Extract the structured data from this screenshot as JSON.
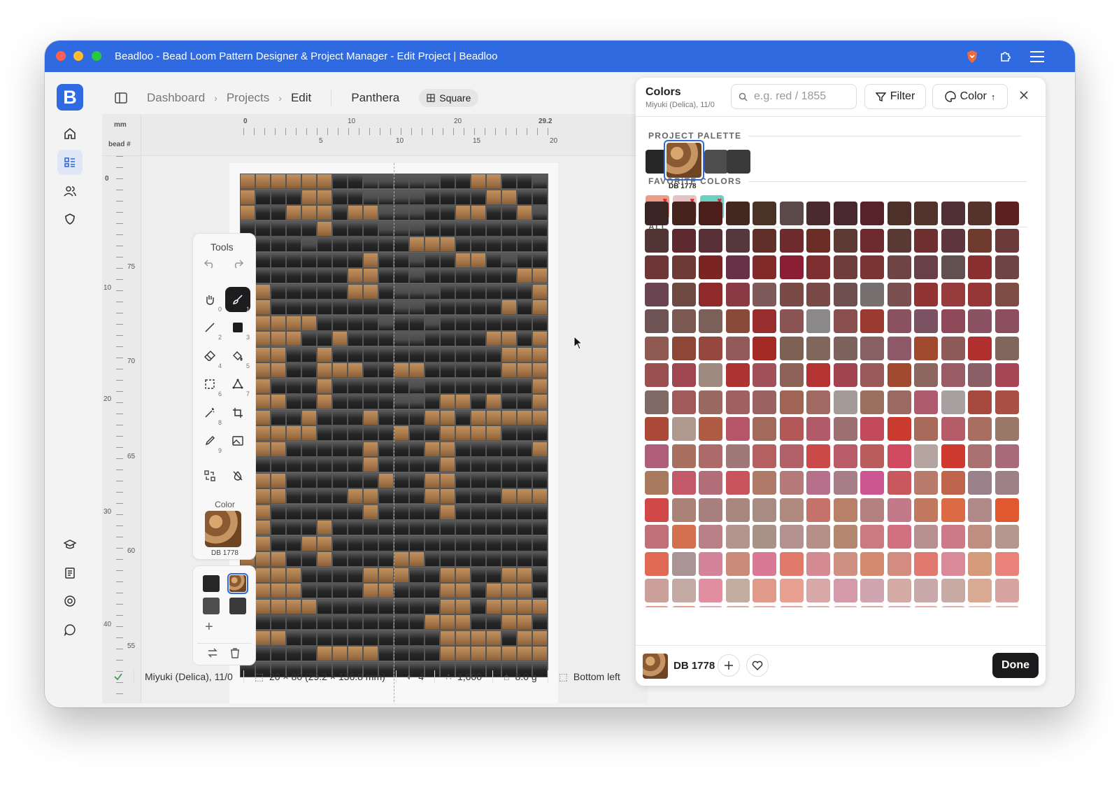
{
  "window": {
    "title": "Beadloo - Bead Loom Pattern Designer & Project Manager - Edit Project | Beadloo",
    "traffic": {
      "close": "#fe5f57",
      "min": "#febc2e",
      "max": "#28c840"
    }
  },
  "brand": {
    "logo_letter": "B",
    "color": "#2f6ae0"
  },
  "breadcrumb": {
    "items": [
      "Dashboard",
      "Projects",
      "Edit"
    ],
    "project": "Panthera",
    "shape": "Square"
  },
  "rulers": {
    "corner_top": "mm",
    "corner_bottom": "bead #",
    "top_mm": [
      "0",
      "10",
      "20",
      "29.2"
    ],
    "top_bead": [
      "5",
      "10",
      "15",
      "20"
    ],
    "left_bead": [
      "0",
      "10",
      "20",
      "30",
      "40"
    ],
    "left_mm": [
      "75",
      "70",
      "65",
      "60",
      "55"
    ]
  },
  "tools": {
    "title": "Tools",
    "color_label": "Color",
    "current_color": "DB 1778",
    "numbers": [
      "0",
      "1",
      "2",
      "3",
      "4",
      "5",
      "6",
      "7",
      "8",
      "9"
    ]
  },
  "pattern": {
    "columns": 20,
    "legend": {
      "K": "#262626",
      "G": "#4d4d4d",
      "B": "#a8784b",
      "D": "#3a3a3a"
    },
    "rows": [
      "BBBBBBKKGGGGGKKBBKKG",
      "BKKKBBKKGGGGKKKKBBKK",
      "BKKBBBKBBGGGKKBBKKBG",
      "KKKKKBKKKGGGKKKKKKKK",
      "KKKKGKKKKKKBBBKKKKKK",
      "KKKKKKKKBKKGKKBBKGKK",
      "KKKKKKKBBKKGKKKKKKBB",
      "KBKKKKKBBKGGGKKKKKKB",
      "BBKKKKKKKKGGKKKKKBKB",
      "BBBBBKKKKGKKGKKKKKKK",
      "BBBBKKBKKKGGKKKKBBKB",
      "BBBKKBKKKKKKKKKKKBBB",
      "BBBKKBBBKKBBKKKKKBBB",
      "BBKKKBKKKKKGKKKKKKKB",
      "BBBKKBKKKKGGKBBKBKKB",
      "BBKKBKKKBKKKBBKBBBBB",
      "BBBBBKKKKKBKKBBBBKKK",
      "BBBKKKKKBKKKBBKKKKKB",
      "BKKKKKKKBKKKKBKKKKKK",
      "BBBKKKKKKBKKBBKKKKKK",
      "BBBKKKKBBKKKBBKKKBBB",
      "BBKKKKKKBKKKKBKKKKKK",
      "BBKKKBKKKKKKKKKKKKKK",
      "BBKKBBKKKKKKKKKKKKKK",
      "BBBKKBKKKKBBKKKKKKKK",
      "BBBBKKKKBBBKKBBKKBBK",
      "BBBBKKKKBBKKKBBKBBBK",
      "BBBBBKKKKKKKKBBKBBBB",
      "BKKKKKKKKKKKBBBKKBBK",
      "BBBKKKKKKKKKKBBBBKBB",
      "KKKKKBBBBKKKKBBBBBBB",
      "KKKKKKKKKKKKKKKKKKKK"
    ]
  },
  "status": {
    "brand": "Miyuki (Delica), 11/0",
    "size": "20 × 80 (29.2 × 136.8 mm)",
    "colors": "4",
    "beads": "1,600",
    "weight": "8.0 g",
    "start": "Bottom left"
  },
  "panel": {
    "title": "Colors",
    "subtitle": "Miyuki (Delica), 11/0",
    "search_placeholder": "e.g. red / 1855",
    "filter_label": "Filter",
    "sort_label": "Color",
    "sections": {
      "project": "PROJECT PALETTE",
      "favorites": "FAVORITE COLORS",
      "all": "ALL"
    },
    "project_palette": [
      "#262626",
      "#a8784b",
      "#4d4d4d",
      "#3a3a3a"
    ],
    "selected_label": "DB 1778",
    "favorites": [
      "#ee9c88",
      "#e6c3c3",
      "#6bd0c0"
    ],
    "footer_color": "DB 1778",
    "done_label": "Done",
    "all_colors": [
      [
        "#3a2424",
        "#47231e",
        "#4b1e1c",
        "#42281f",
        "#4a3326",
        "#5c4a4a",
        "#4b2a2e",
        "#48292f",
        "#57222a",
        "#4d3029",
        "#51332c",
        "#503034",
        "#55322a",
        "#5c2020"
      ],
      [
        "#523535",
        "#5e2a30",
        "#5a3038",
        "#55383d",
        "#62302a",
        "#6e2a2c",
        "#6a2e26",
        "#5e3a34",
        "#6e2a2e",
        "#5a3a34",
        "#6e3030",
        "#60363e",
        "#6e3a2e",
        "#6a3a3a"
      ],
      [
        "#6e3636",
        "#6e3a36",
        "#7a2424",
        "#6a3048",
        "#802a2a",
        "#8a1e34",
        "#7e3030",
        "#6e3e3e",
        "#7a3434",
        "#6e4444",
        "#6a4048",
        "#605050",
        "#8a3030",
        "#6e4444"
      ],
      [
        "#6a4450",
        "#6e4a42",
        "#8e2a2a",
        "#8a3a44",
        "#7e5a5a",
        "#7a4a46",
        "#7a4a48",
        "#6e5050",
        "#777070",
        "#7a5050",
        "#923434",
        "#963c3c",
        "#963636",
        "#7e4e44"
      ],
      [
        "#6e5454",
        "#7a5a52",
        "#7a6058",
        "#8a4a3a",
        "#982e2e",
        "#8a5454",
        "#8a8888",
        "#8a5050",
        "#9a3a30",
        "#8a5260",
        "#7a5262",
        "#8e4a58",
        "#8a5262",
        "#8a4e5e"
      ],
      [
        "#8e5a52",
        "#8e4636",
        "#964840",
        "#925a5a",
        "#a42a26",
        "#7e6054",
        "#80665c",
        "#7e625e",
        "#866062",
        "#8e5a6a",
        "#a24a30",
        "#8e5a5a",
        "#b03030",
        "#80665c"
      ],
      [
        "#9a5050",
        "#a04650",
        "#9e8a80",
        "#ae3434",
        "#a2505a",
        "#8e6258",
        "#b43434",
        "#a24450",
        "#9a5a5a",
        "#a24a30",
        "#8e6660",
        "#9a5c64",
        "#8a6066",
        "#a84658"
      ],
      [
        "#806a66",
        "#a05a5a",
        "#9a6a60",
        "#a06060",
        "#9a6260",
        "#a06454",
        "#a06a62",
        "#a49a98",
        "#9a7060",
        "#9c6a62",
        "#b05a6e",
        "#a8a0a0",
        "#a64a40",
        "#a85044"
      ],
      [
        "#ac4a3a",
        "#b09a90",
        "#b05c44",
        "#b85468",
        "#a26a5a",
        "#b25858",
        "#b05a6a",
        "#9c7070",
        "#c24a5a",
        "#ca3a2e",
        "#a86a5a",
        "#b45c68",
        "#a86e62",
        "#9a7868"
      ],
      [
        "#ae5e78",
        "#a87060",
        "#ac6a6a",
        "#a07878",
        "#b46060",
        "#b2606a",
        "#ca4a4a",
        "#b85c6a",
        "#ba5c5c",
        "#d04a60",
        "#b4a4a0",
        "#ce3a30",
        "#a87070",
        "#a86a78"
      ],
      [
        "#a87a60",
        "#c25a6c",
        "#b46e7a",
        "#c8545e",
        "#b07a68",
        "#b47a7a",
        "#b6708a",
        "#a87e88",
        "#cc5690",
        "#c8585e",
        "#b87a6a",
        "#c0644e",
        "#9a8088",
        "#9e8088"
      ],
      [
        "#d24848",
        "#aa8278",
        "#a88080",
        "#a8887e",
        "#a88c84",
        "#b08a7e",
        "#c4726a",
        "#b88068",
        "#b48080",
        "#c27a88",
        "#c0785e",
        "#dc6a44",
        "#b08a88",
        "#e0582e"
      ],
      [
        "#c07078",
        "#d27050",
        "#ba8088",
        "#b4948e",
        "#a89288",
        "#b49290",
        "#b49088",
        "#b48870",
        "#cc7a80",
        "#d07080",
        "#b89090",
        "#cc7a88",
        "#c08e80",
        "#b49890"
      ],
      [
        "#e06a54",
        "#aa9494",
        "#d4849a",
        "#cc8a7a",
        "#d87a96",
        "#e07a6a",
        "#d48a92",
        "#ce9080",
        "#d48a6e",
        "#d28c80",
        "#e07a70",
        "#d88a98",
        "#d49a7a",
        "#e8827a"
      ],
      [
        "#cca09a",
        "#c4aaa4",
        "#e08ea0",
        "#c4aca0",
        "#e09a8a",
        "#e8a090",
        "#d8a8a8",
        "#d49aaa",
        "#d0a4b0",
        "#d4aaa4",
        "#c8a8a8",
        "#c8aaa4",
        "#d8aa94",
        "#d8a4a0"
      ],
      [
        "#e0a08e",
        "#e4a08a",
        "#e0aab0",
        "#d8aaa8",
        "#e8aaa0",
        "#e4a4a0",
        "#d8b0ae",
        "#e0b4b4",
        "#e0aaa4",
        "#e0aab0",
        "#e8a8a8",
        "#e0b0b0",
        "#ecc4c4",
        "#e8b4b4"
      ]
    ]
  }
}
